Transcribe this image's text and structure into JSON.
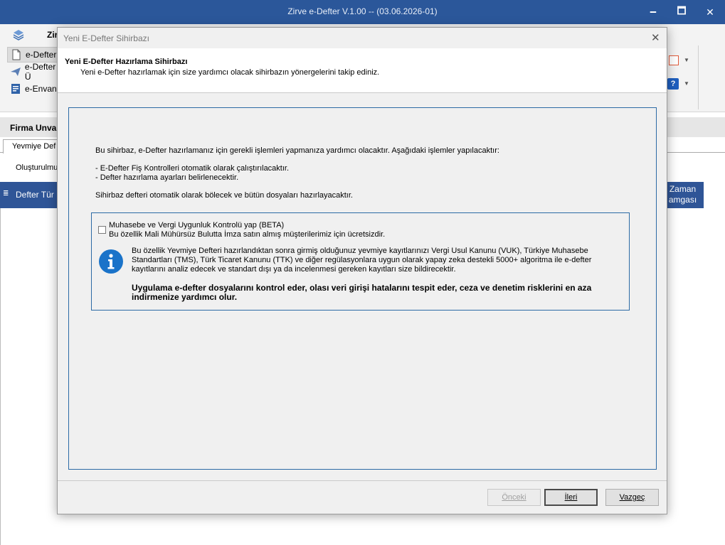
{
  "app": {
    "title": "Zirve e-Defter V.1.00  -- (03.06.2026-01)",
    "minimize": "🗕",
    "maximize": "🗖",
    "close": "✕"
  },
  "ribbon": {
    "tab": "Zir",
    "items": [
      {
        "label": "e-Defter I"
      },
      {
        "label": "e-Defter Ü"
      },
      {
        "label": "e-Envant"
      }
    ],
    "help_glyph": "?",
    "dropdown_glyph": "▼"
  },
  "background": {
    "firm_label": "Firma Unva",
    "active_tab": "Yevmiye Def",
    "status": "Oluşturulmu",
    "grid_header_left_glyph": "≣",
    "grid_header_left": "Defter Tür",
    "grid_header_right_line1": "Zaman",
    "grid_header_right_line2": "amgası"
  },
  "dialog": {
    "title": "Yeni E-Defter Sihirbazı",
    "close": "✕",
    "header_title": "Yeni E-Defter Hazırlama Sihirbazı",
    "header_subtitle": "Yeni e-Defter hazırlamak için size yardımcı olacak sihirbazın yönergelerini takip ediniz.",
    "intro": "Bu sihirbaz, e-Defter hazırlamanız için gerekli işlemleri yapmanıza yardımcı olacaktır. Aşağıdaki işlemler yapılacaktır:",
    "steps": [
      "- E-Defter Fiş Kontrolleri otomatik olarak çalıştırılacaktır.",
      "- Defter hazırlama ayarları belirlenecektir."
    ],
    "auto_split": "Sihirbaz defteri otomatik olarak bölecek ve bütün dosyaları hazırlayacaktır.",
    "beta": {
      "checkbox_label": "Muhasebe ve Vergi Uygunluk Kontrolü yap (BETA)",
      "checked": false,
      "checkbox_sub": "Bu özellik Mali Mühürsüz Bulutta İmza satın almış müşterilerimiz için ücretsizdir.",
      "info_icon": "info-icon",
      "info_text": "Bu özellik Yevmiye Defteri hazırlandıktan sonra girmiş olduğunuz yevmiye kayıtlarınızı Vergi Usul Kanunu (VUK), Türkiye Muhasebe Standartları (TMS), Türk Ticaret Kanunu (TTK) ve diğer regülasyonlara uygun olarak yapay zeka destekli 5000+ algoritma ile e-defter kayıtlarını analiz edecek ve standart dışı ya da incelenmesi gereken kayıtları size bildirecektir.",
      "info_bold": "Uygulama e-defter dosyalarını kontrol eder, olası veri girişi hatalarını tespit eder, ceza ve denetim risklerini en aza indirmenize yardımcı olur."
    },
    "buttons": {
      "prev": "Önceki",
      "next": "İleri",
      "cancel": "Vazgeç"
    },
    "accent_color": "#2c6aa5"
  }
}
